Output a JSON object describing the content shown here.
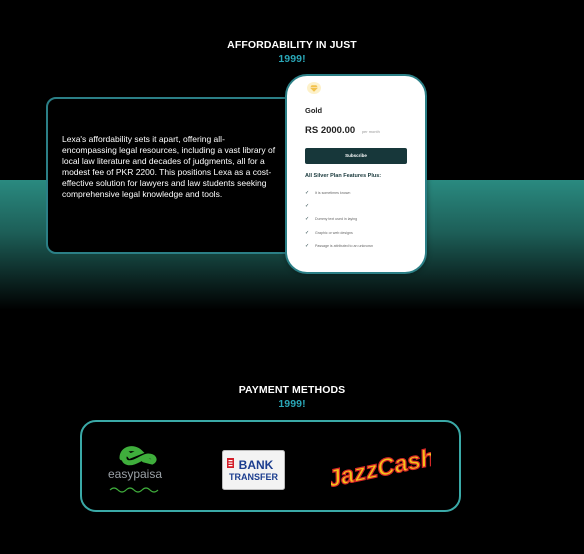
{
  "afford": {
    "title": "AFFORDABILITY IN JUST",
    "accent": "1999!",
    "body": "Lexa's affordability sets it apart, offering all-encompassing legal resources, including a vast library of local law literature and decades of judgments, all for a modest fee of PKR 2200. This positions Lexa as a cost-effective solution for lawyers and law students seeking comprehensive legal knowledge and tools."
  },
  "plan": {
    "icon": "diamond-icon",
    "name": "Gold",
    "price": "RS 2000.00",
    "period": "per month",
    "subscribe_label": "Subscribe",
    "features_title": "All Silver Plan Features Plus:",
    "features": [
      "It is sometimes known",
      "",
      "Dummy text used in laying",
      "Graphic or web designs",
      "Passage is attributed to an unknown"
    ]
  },
  "payment": {
    "title": "PAYMENT METHODS",
    "accent": "1999!",
    "logos": {
      "easypaisa": "easypaisa",
      "bank_line1": "BANK",
      "bank_line2": "TRANSFER",
      "jazzcash": "JazzCash"
    }
  },
  "colors": {
    "accent": "#2aa7b7",
    "teal_border": "#2b7f86",
    "dark_button": "#17373a",
    "easypaisa_green": "#3fae3c",
    "jazz_yellow": "#f4c21b",
    "jazz_red": "#d42727"
  }
}
